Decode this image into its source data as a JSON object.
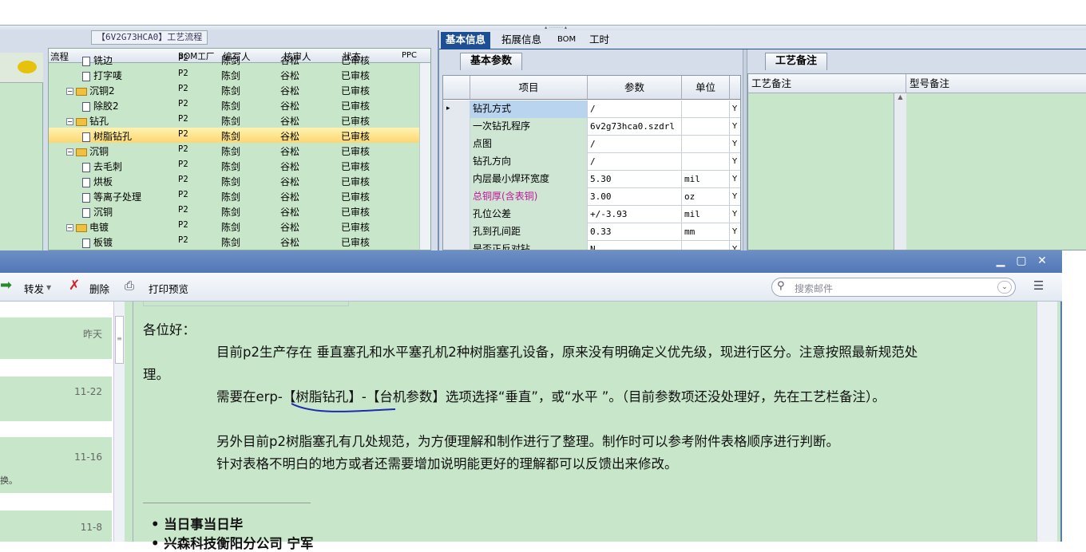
{
  "left_panel": {
    "title": "【6V2G73HCA0】工艺流程",
    "headers": [
      "流程",
      "BOM工厂",
      "编写人",
      "核审人",
      "状态",
      "PPC"
    ],
    "rows": [
      {
        "name": "铣边",
        "level": 2,
        "factory": "P2",
        "writer": "陈剑",
        "reviewer": "谷松",
        "status": "已审核"
      },
      {
        "name": "打字唛",
        "level": 2,
        "factory": "P2",
        "writer": "陈剑",
        "reviewer": "谷松",
        "status": "已审核"
      },
      {
        "name": "沉铜2",
        "level": 1,
        "factory": "P2",
        "writer": "陈剑",
        "reviewer": "谷松",
        "status": "已审核"
      },
      {
        "name": "除胶2",
        "level": 2,
        "factory": "P2",
        "writer": "陈剑",
        "reviewer": "谷松",
        "status": "已审核"
      },
      {
        "name": "钻孔",
        "level": 1,
        "factory": "P2",
        "writer": "陈剑",
        "reviewer": "谷松",
        "status": "已审核"
      },
      {
        "name": "树脂钻孔",
        "level": 2,
        "factory": "P2",
        "writer": "陈剑",
        "reviewer": "谷松",
        "status": "已审核",
        "selected": true
      },
      {
        "name": "沉铜",
        "level": 1,
        "factory": "P2",
        "writer": "陈剑",
        "reviewer": "谷松",
        "status": "已审核"
      },
      {
        "name": "去毛刺",
        "level": 2,
        "factory": "P2",
        "writer": "陈剑",
        "reviewer": "谷松",
        "status": "已审核"
      },
      {
        "name": "烘板",
        "level": 2,
        "factory": "P2",
        "writer": "陈剑",
        "reviewer": "谷松",
        "status": "已审核"
      },
      {
        "name": "等离子处理",
        "level": 2,
        "factory": "P2",
        "writer": "陈剑",
        "reviewer": "谷松",
        "status": "已审核"
      },
      {
        "name": "沉铜",
        "level": 2,
        "factory": "P2",
        "writer": "陈剑",
        "reviewer": "谷松",
        "status": "已审核"
      },
      {
        "name": "电镀",
        "level": 1,
        "factory": "P2",
        "writer": "陈剑",
        "reviewer": "谷松",
        "status": "已审核"
      },
      {
        "name": "板镀",
        "level": 2,
        "factory": "P2",
        "writer": "陈剑",
        "reviewer": "谷松",
        "status": "已审核"
      }
    ]
  },
  "right_panel": {
    "tabs": [
      "基本信息",
      "拓展信息",
      "BOM",
      "工时"
    ],
    "subtab": "基本参数",
    "headers": [
      "项目",
      "参数",
      "单位"
    ],
    "rows": [
      {
        "item": "钻孔方式",
        "value": "/",
        "unit": "",
        "flag": "Y"
      },
      {
        "item": "一次钻孔程序",
        "value": "6v2g73hca0.szdrl",
        "unit": "",
        "flag": "Y"
      },
      {
        "item": "点图",
        "value": "/",
        "unit": "",
        "flag": "Y"
      },
      {
        "item": "钻孔方向",
        "value": "/",
        "unit": "",
        "flag": "Y"
      },
      {
        "item": "内层最小焊环宽度",
        "value": "5.30",
        "unit": "mil",
        "flag": "Y"
      },
      {
        "item": "总铜厚(含表铜)",
        "value": "3.00",
        "unit": "oz",
        "flag": "Y"
      },
      {
        "item": "孔位公差",
        "value": "+/-3.93",
        "unit": "mil",
        "flag": "Y"
      },
      {
        "item": "孔到孔间距",
        "value": "0.33",
        "unit": "mm",
        "flag": "Y"
      },
      {
        "item": "是否正反对钻",
        "value": "N",
        "unit": "",
        "flag": "Y"
      }
    ],
    "notes_tab": "工艺备注",
    "notes_headers": [
      "工艺备注",
      "型号备注"
    ]
  },
  "mail": {
    "toolbar": {
      "forward": "转发",
      "delete": "删除",
      "print": "打印预览"
    },
    "search_placeholder": "搜索邮件",
    "list_dates": [
      "昨天",
      "11-22",
      "11-16",
      "11-8"
    ],
    "list_snippet": "换。",
    "greeting": "各位好：",
    "para1a": "目前p2生产存在 垂直塞孔和水平塞孔机2种树脂塞孔设备，原来没有明确定义优先级，现进行区分。注意按照最新规范处",
    "para1b": "理。",
    "para2": "需要在erp-【树脂钻孔】-【台机参数】选项选择“垂直”，或“水平 ”。（目前参数项还没处理好，先在工艺栏备注）。",
    "para3": "另外目前p2树脂塞孔有几处规范，为方便理解和制作进行了整理。制作时可以参考附件表格顺序进行判断。",
    "para4": "针对表格不明白的地方或者还需要增加说明能更好的理解都可以反馈出来修改。",
    "bullet1": "当日事当日毕",
    "bullet2": "兴森科技衡阳分公司  宁军"
  }
}
